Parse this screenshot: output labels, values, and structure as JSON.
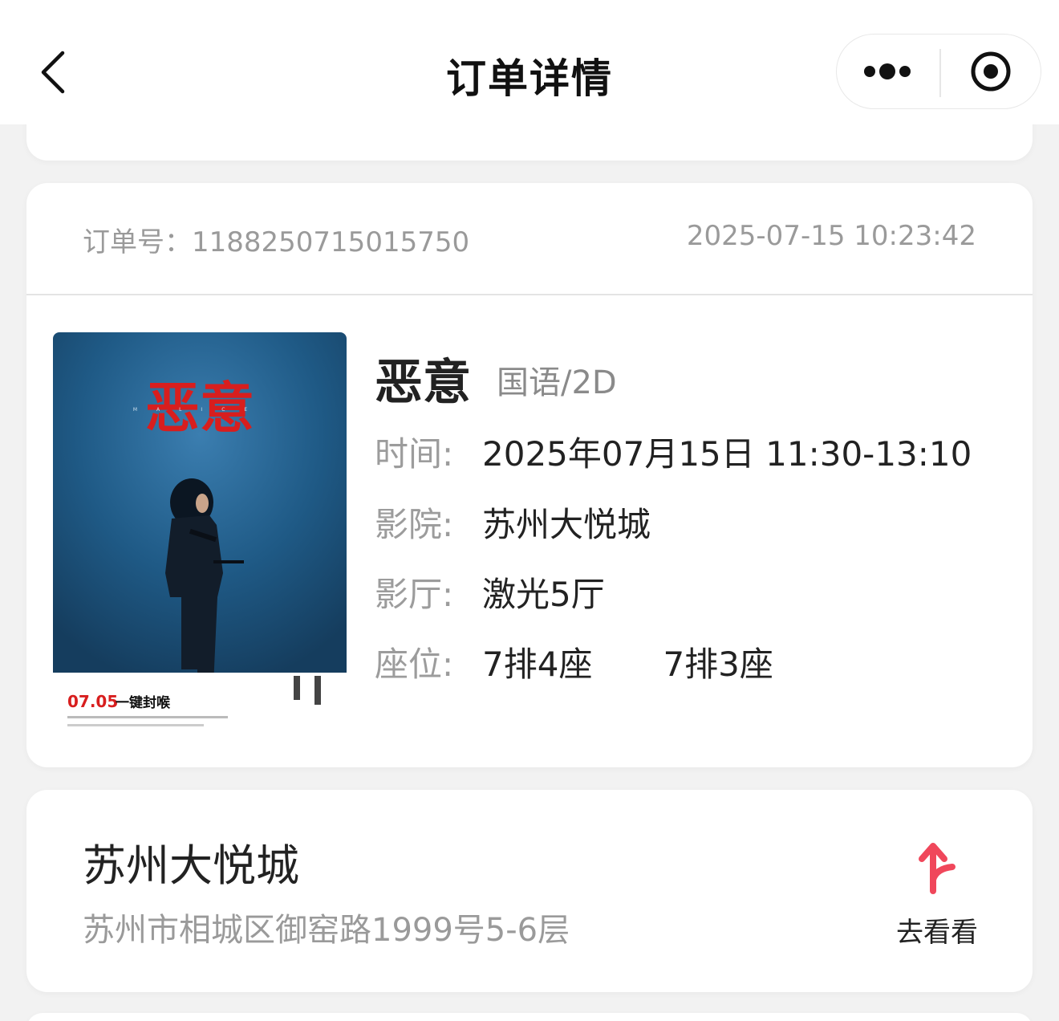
{
  "header": {
    "title": "订单详情",
    "back_icon": "chevron-left-icon",
    "more_icon": "more-dots-icon",
    "close_icon": "target-circle-icon"
  },
  "order": {
    "order_no_label": "订单号：",
    "order_no": "1188250715015750",
    "created_time": "2025-07-15 10:23:42"
  },
  "movie": {
    "title": "恶意",
    "format": "国语/2D",
    "poster": {
      "title_text": "恶意",
      "subtitle": "MALICE",
      "release_text": "07.05",
      "tagline": "一键封喉",
      "accent_color": "#d81e1e",
      "background_color": "#1e4e75"
    },
    "time_label": "时间:",
    "time_value": "2025年07月15日 11:30-13:10",
    "cinema_label": "影院:",
    "cinema_value": "苏州大悦城",
    "hall_label": "影厅:",
    "hall_value": "激光5厅",
    "seat_label": "座位:",
    "seats": [
      "7排4座",
      "7排3座"
    ]
  },
  "cinema": {
    "name": "苏州大悦城",
    "address": "苏州市相城区御窑路1999号5-6层",
    "go_label": "去看看",
    "go_icon": "navigation-arrow-icon",
    "accent_color": "#f0475b"
  }
}
